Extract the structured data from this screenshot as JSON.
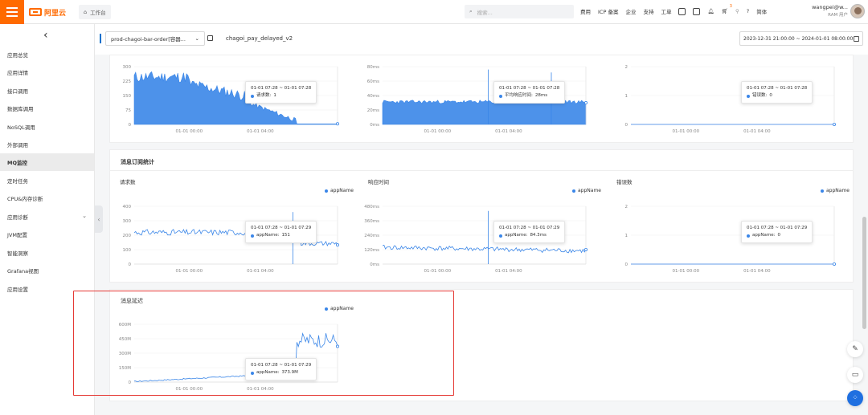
{
  "topbar": {
    "logo_text": "阿里云",
    "workbench_label": "工作台",
    "search_placeholder": "搜索...",
    "nav": [
      "费用",
      "ICP 备案",
      "企业",
      "支持",
      "工单"
    ],
    "lang_label": "简体",
    "cart_badge": "3",
    "user_name": "wangpei@w...",
    "user_role": "RAM 用户"
  },
  "sidebar": {
    "items": [
      {
        "label": "应用总览"
      },
      {
        "label": "应用详情"
      },
      {
        "label": "接口调用"
      },
      {
        "label": "数据库调用"
      },
      {
        "label": "NoSQL调用"
      },
      {
        "label": "外部调用"
      },
      {
        "label": "MQ监控",
        "active": true
      },
      {
        "label": "定时任务"
      },
      {
        "label": "CPU&内存诊断"
      },
      {
        "label": "应用诊断",
        "expandable": true
      },
      {
        "label": "JVM配置"
      },
      {
        "label": "智能洞察"
      },
      {
        "label": "Grafana视图"
      },
      {
        "label": "应用设置"
      }
    ]
  },
  "filter": {
    "app_select": "prod-chagoi-bar-order[容器...",
    "metric_name": "chagoi_pay_delayed_v2",
    "time_range": "2023-12-31 21:00:00 ~ 2024-01-01 08:00:00"
  },
  "sections": {
    "subscribe_title": "消息订阅统计",
    "delay_title": "消息延迟"
  },
  "charts": {
    "top_req": {
      "yticks": [
        "300",
        "225",
        "150",
        "75",
        "0"
      ],
      "xticks": [
        "01-01 00:00",
        "01-01 04:00"
      ],
      "tooltip_time": "01-01 07:28 ~ 01-01 07:28",
      "tooltip_label": "请求数:",
      "tooltip_value": "1"
    },
    "top_rt": {
      "yticks": [
        "80ms",
        "60ms",
        "40ms",
        "20ms",
        "0ms"
      ],
      "xticks": [
        "01-01 00:00",
        "01-01 04:00"
      ],
      "tooltip_time": "01-01 07:28 ~ 01-01 07:28",
      "tooltip_label": "平均响应时间:",
      "tooltip_value": "28ms"
    },
    "top_err": {
      "yticks": [
        "2",
        "1",
        "0"
      ],
      "xticks": [
        "01-01 00:00",
        "01-01 04:00"
      ],
      "tooltip_time": "01-01 07:28 ~ 01-01 07:28",
      "tooltip_label": "错误数:",
      "tooltip_value": "0"
    },
    "sub_req": {
      "title": "请求数",
      "legend": "appName",
      "yticks": [
        "400",
        "300",
        "200",
        "100",
        "0"
      ],
      "xticks": [
        "01-01 00:00",
        "01-01 04:00"
      ],
      "tooltip_time": "01-01 07:28 ~ 01-01 07:29",
      "tooltip_label": "appName:",
      "tooltip_value": "151"
    },
    "sub_rt": {
      "title": "响应时间",
      "legend": "appName",
      "yticks": [
        "480ms",
        "360ms",
        "240ms",
        "120ms",
        "0ms"
      ],
      "xticks": [
        "01-01 00:00",
        "01-01 04:00"
      ],
      "tooltip_time": "01-01 07:28 ~ 01-01 07:29",
      "tooltip_label": "appName:",
      "tooltip_value": "84.3ms"
    },
    "sub_err": {
      "title": "错误数",
      "legend": "appName",
      "yticks": [
        "2",
        "1",
        "0"
      ],
      "xticks": [
        "01-01 00:00",
        "01-01 04:00"
      ],
      "tooltip_time": "01-01 07:28 ~ 01-01 07:29",
      "tooltip_label": "appName:",
      "tooltip_value": "0"
    },
    "delay": {
      "legend": "appName",
      "yticks": [
        "600M",
        "450M",
        "300M",
        "150M",
        "0"
      ],
      "xticks": [
        "01-01 00:00",
        "01-01 04:00"
      ],
      "tooltip_time": "01-01 07:28 ~ 01-01 07:29",
      "tooltip_label": "appName:",
      "tooltip_value": "373.9M"
    }
  },
  "colors": {
    "accent": "#ff6a00",
    "series": "#3a86e8",
    "highlight": "#e53935",
    "primary_fab": "#1f6fe0"
  }
}
